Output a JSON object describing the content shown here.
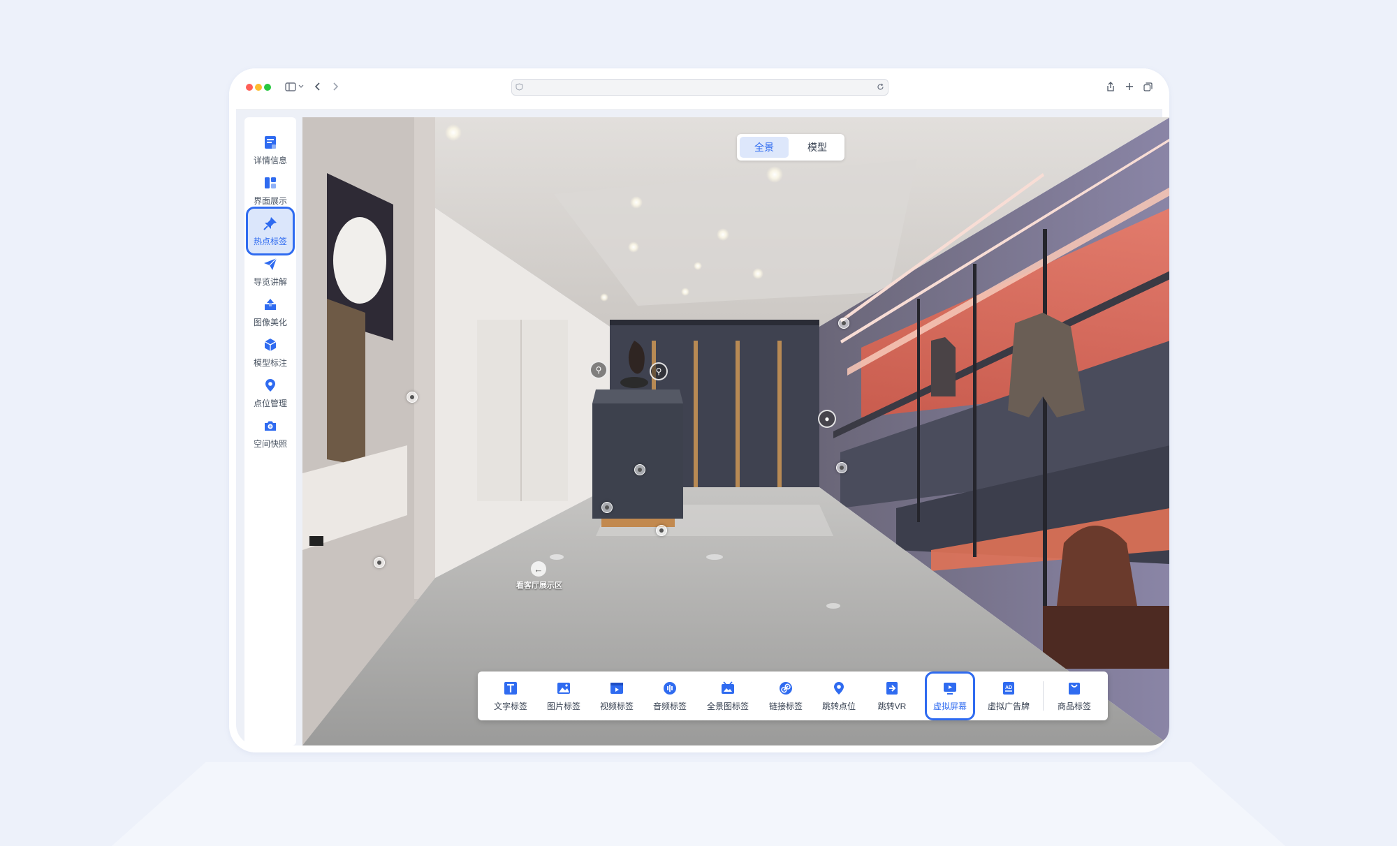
{
  "sidebar": {
    "items": [
      {
        "label": "详情信息",
        "icon": "document-icon"
      },
      {
        "label": "界面展示",
        "icon": "layout-icon"
      },
      {
        "label": "热点标签",
        "icon": "pin-icon",
        "active": true
      },
      {
        "label": "导览讲解",
        "icon": "paper-plane-icon"
      },
      {
        "label": "图像美化",
        "icon": "image-enhance-icon"
      },
      {
        "label": "模型标注",
        "icon": "cube-icon"
      },
      {
        "label": "点位管理",
        "icon": "location-icon"
      },
      {
        "label": "空间快照",
        "icon": "camera-icon"
      }
    ]
  },
  "viewer": {
    "mode_toggle": {
      "options": [
        "全景",
        "模型"
      ],
      "selected": "全景"
    },
    "nav_hotspot_label": "看客厅展示区"
  },
  "toolbar": {
    "items": [
      {
        "label": "文字标签",
        "icon": "text-icon"
      },
      {
        "label": "图片标签",
        "icon": "image-icon"
      },
      {
        "label": "视频标签",
        "icon": "video-icon"
      },
      {
        "label": "音频标签",
        "icon": "audio-icon"
      },
      {
        "label": "全景图标签",
        "icon": "panorama-icon"
      },
      {
        "label": "链接标签",
        "icon": "link-icon"
      },
      {
        "label": "跳转点位",
        "icon": "location-icon"
      },
      {
        "label": "跳转VR",
        "icon": "jump-vr-icon"
      },
      {
        "label": "虚拟屏幕",
        "icon": "screen-icon",
        "active": true
      },
      {
        "label": "虚拟广告牌",
        "icon": "ad-icon"
      },
      {
        "label": "商品标签",
        "icon": "shopping-bag-icon"
      }
    ]
  },
  "colors": {
    "accent": "#2f6bf0",
    "active_bg": "#dbe6fb",
    "page_bg": "#edf1fa"
  }
}
